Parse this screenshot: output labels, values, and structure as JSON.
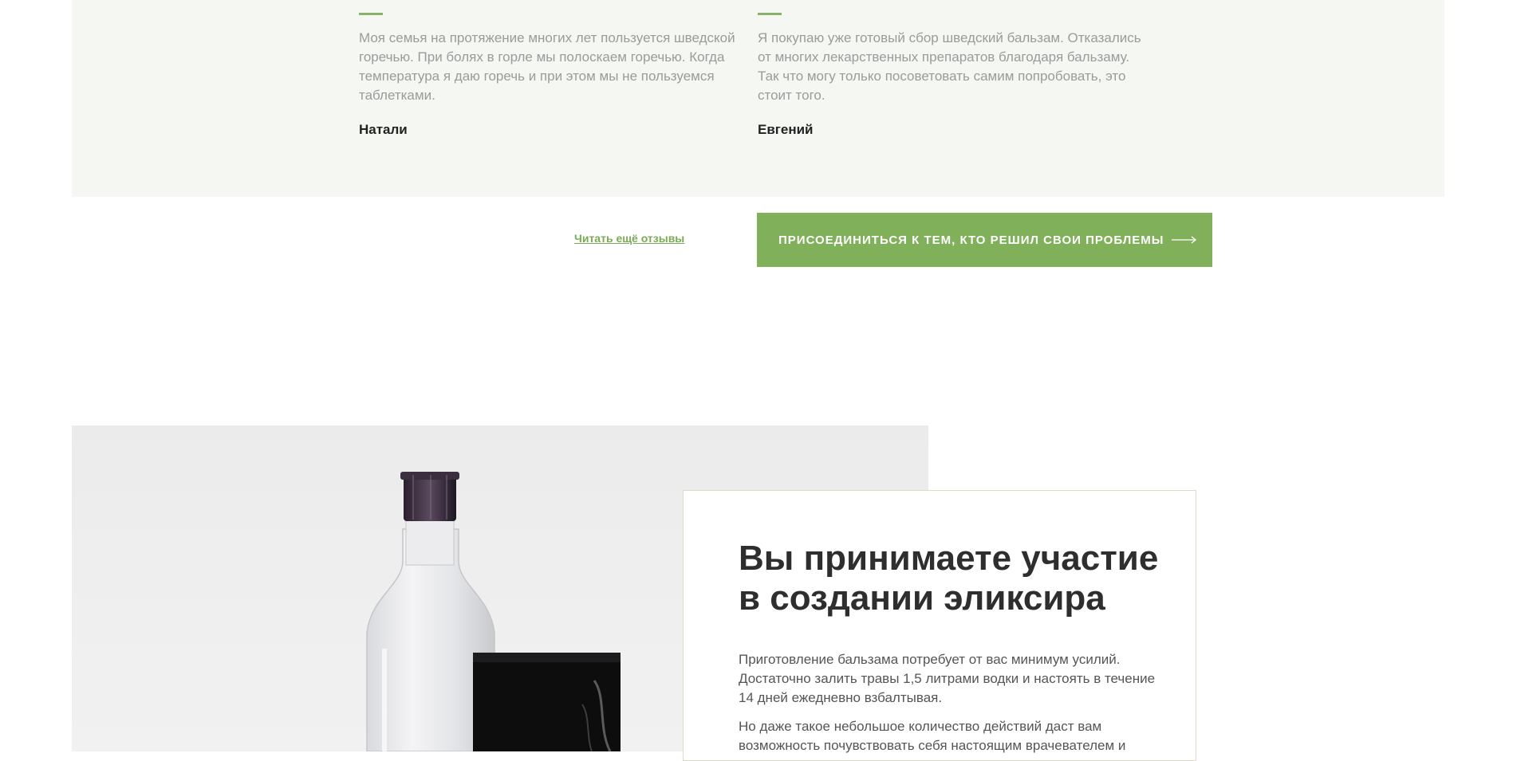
{
  "reviews": [
    {
      "text": "Моя семья на протяжение многих лет пользуется шведской горечью. При болях в горле мы полоскаем горечью. Когда температура я даю горечь и при этом мы не пользуемся таблетками.",
      "author": "Натали"
    },
    {
      "text": "Я покупаю уже готовый сбор шведский бальзам. Отказались от многих лекарственных препаратов благодаря бальзаму. Так что могу только посоветовать самим попробовать, это стоит того.",
      "author": "Евгений"
    }
  ],
  "actions": {
    "more_reviews_link": "Читать ещё отзывы",
    "join_button": "ПРИСОЕДИНИТЬСЯ К ТЕМ, КТО РЕШИЛ СВОИ ПРОБЛЕМЫ"
  },
  "elixir": {
    "title": "Вы принимаете участие в создании эликсира",
    "paragraph1": "Приготовление бальзама потребует от вас минимум усилий. Достаточно залить травы 1,5 литрами водки и настоять в течение 14 дней ежедневно взбалтывая.",
    "paragraph2": "Но даже такое небольшое количество действий даст вам возможность почувствовать себя настоящим врачевателем и"
  },
  "colors": {
    "accent_green": "#80b15a",
    "link_green": "#7aab55",
    "band_background": "#f5f7f3"
  },
  "icons": {
    "button_arrow": "long-arrow-right-icon"
  }
}
